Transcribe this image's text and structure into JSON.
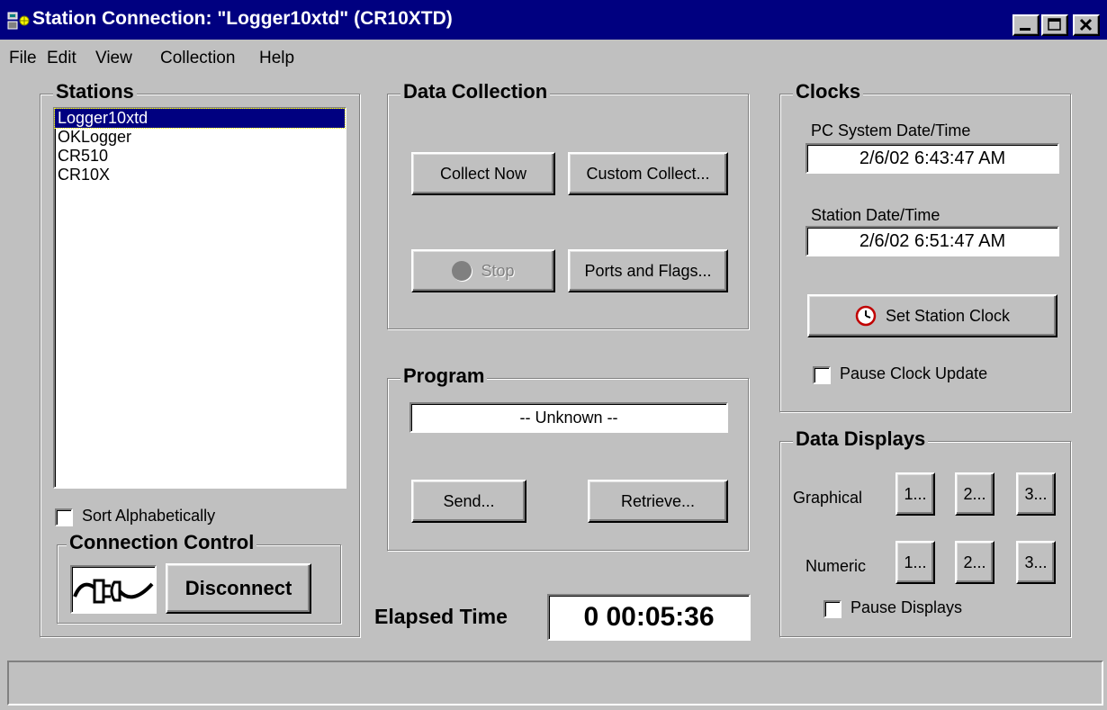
{
  "window": {
    "title": "Station Connection:  \"Logger10xtd\" (CR10XTD)"
  },
  "menu": [
    "File",
    "Edit",
    "View",
    "Collection",
    "Help"
  ],
  "stations": {
    "title": "Stations",
    "items": [
      "Logger10xtd",
      "OKLogger",
      "CR510",
      "CR10X"
    ],
    "selected": "Logger10xtd",
    "sort_label": "Sort Alphabetically",
    "sort_checked": false
  },
  "connection": {
    "title": "Connection Control",
    "disconnect_label": "Disconnect"
  },
  "data_collection": {
    "title": "Data Collection",
    "collect_now": "Collect Now",
    "custom_collect": "Custom Collect...",
    "stop": "Stop",
    "ports_flags": "Ports and Flags..."
  },
  "program": {
    "title": "Program",
    "status": "-- Unknown --",
    "send": "Send...",
    "retrieve": "Retrieve..."
  },
  "elapsed": {
    "label": "Elapsed Time",
    "value": "0 00:05:36"
  },
  "clocks": {
    "title": "Clocks",
    "pc_label": "PC System Date/Time",
    "pc_value": "2/6/02 6:43:47 AM",
    "station_label": "Station Date/Time",
    "station_value": "2/6/02 6:51:47 AM",
    "set_clock": "Set Station Clock",
    "pause_label": "Pause Clock Update",
    "pause_checked": false
  },
  "data_displays": {
    "title": "Data Displays",
    "graphical_label": "Graphical",
    "numeric_label": "Numeric",
    "buttons": [
      "1...",
      "2...",
      "3..."
    ],
    "pause_label": "Pause Displays",
    "pause_checked": false
  },
  "status_bar": {
    "text": ""
  }
}
